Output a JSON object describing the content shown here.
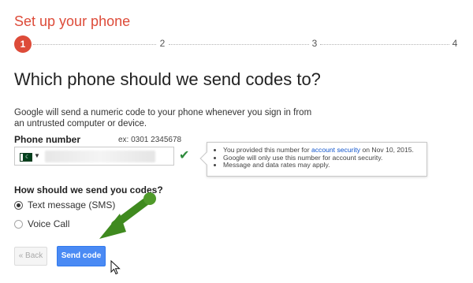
{
  "title": "Set up your phone",
  "stepper": {
    "steps": [
      "1",
      "2",
      "3",
      "4"
    ],
    "current": 1
  },
  "heading": "Which phone should we send codes to?",
  "description": "Google will send a numeric code to your phone whenever you sign in from an untrusted computer or device.",
  "phone": {
    "label": "Phone number",
    "example": "ex: 0301 2345678",
    "country_flag": "pakistan-flag-icon",
    "verified_icon": "checkmark-icon"
  },
  "tooltip": {
    "line1_pre": "You provided this number for ",
    "line1_link": "account security",
    "line1_post": " on Nov 10, 2015.",
    "line2": "Google will only use this number for account security.",
    "line3": "Message and data rates may apply."
  },
  "delivery": {
    "label": "How should we send you codes?",
    "options": [
      {
        "label": "Text message (SMS)",
        "selected": true
      },
      {
        "label": "Voice Call",
        "selected": false
      }
    ]
  },
  "buttons": {
    "back": "« Back",
    "send": "Send code"
  },
  "colors": {
    "accent_red": "#dd4b39",
    "primary_blue": "#4a8af4",
    "link_blue": "#1155cc",
    "check_green": "#2e8b3c",
    "annotation_arrow": "#3f8a1f"
  }
}
